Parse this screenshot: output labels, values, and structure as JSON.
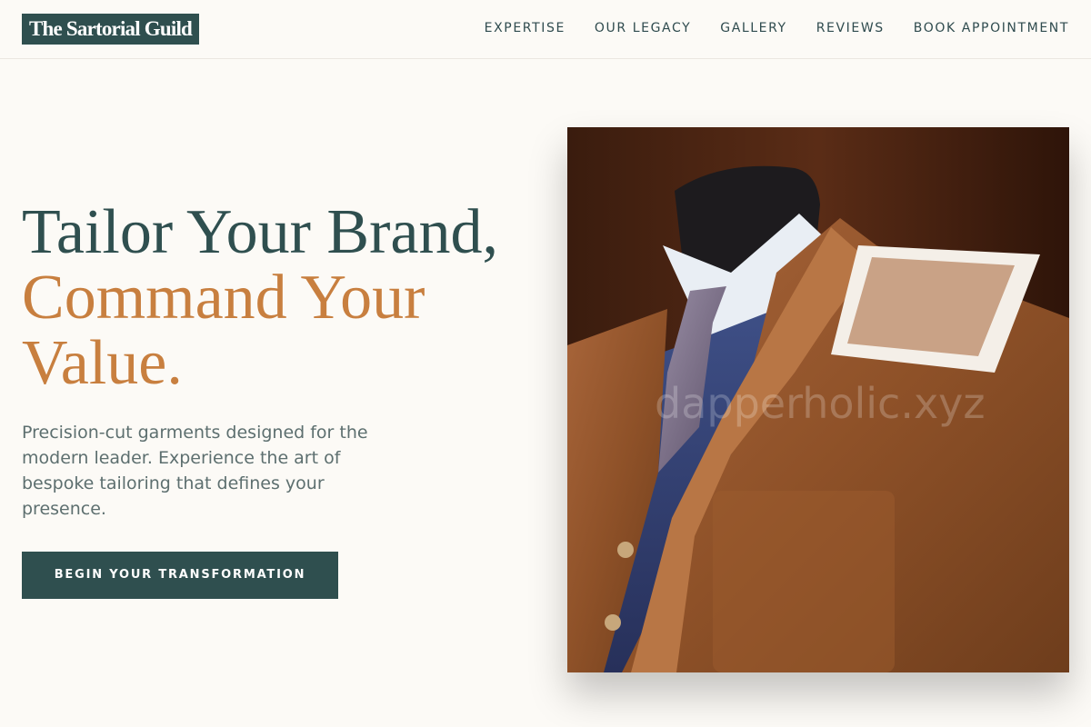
{
  "brand": {
    "name": "The Sartorial Guild"
  },
  "nav": {
    "links": [
      {
        "label": "EXPERTISE"
      },
      {
        "label": "OUR LEGACY"
      },
      {
        "label": "GALLERY"
      },
      {
        "label": "REVIEWS"
      },
      {
        "label": "BOOK APPOINTMENT"
      }
    ]
  },
  "hero": {
    "headline_line1": "Tailor Your Brand,",
    "headline_accent_line1": "Command Your",
    "headline_accent_line2": "Value.",
    "description": "Precision-cut garments designed for the modern leader. Experience the art of bespoke tailoring that defines your presence.",
    "cta_label": "BEGIN YOUR TRANSFORMATION",
    "image_watermark": "dapperholic.xyz"
  },
  "colors": {
    "primary": "#2f4f4f",
    "accent": "#c87f3f",
    "background": "#fcfaf6"
  }
}
